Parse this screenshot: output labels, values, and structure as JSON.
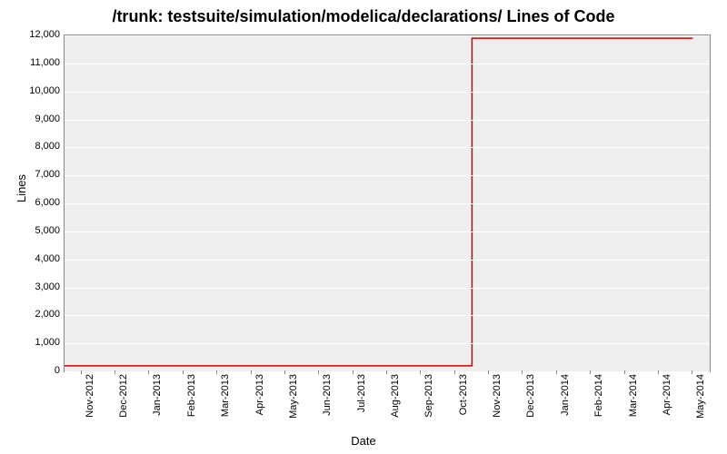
{
  "chart_data": {
    "type": "line",
    "title": "/trunk: testsuite/simulation/modelica/declarations/ Lines of Code",
    "xlabel": "Date",
    "ylabel": "Lines",
    "ylim": [
      0,
      12000
    ],
    "y_ticks": [
      0,
      1000,
      2000,
      3000,
      4000,
      5000,
      6000,
      7000,
      8000,
      9000,
      10000,
      11000,
      12000
    ],
    "y_tick_labels": [
      "0",
      "1,000",
      "2,000",
      "3,000",
      "4,000",
      "5,000",
      "6,000",
      "7,000",
      "8,000",
      "9,000",
      "10,000",
      "11,000",
      "12,000"
    ],
    "x_categories": [
      "Nov-2012",
      "Dec-2012",
      "Jan-2013",
      "Feb-2013",
      "Mar-2013",
      "Apr-2013",
      "May-2013",
      "Jun-2013",
      "Jul-2013",
      "Aug-2013",
      "Sep-2013",
      "Oct-2013",
      "Nov-2013",
      "Dec-2013",
      "Jan-2014",
      "Feb-2014",
      "Mar-2014",
      "Apr-2014",
      "May-2014"
    ],
    "series": [
      {
        "name": "Lines of Code",
        "color": "#d00000",
        "points": [
          {
            "x": "mid-Oct-2012",
            "y": 200
          },
          {
            "x": "mid-Oct-2013",
            "y": 200
          },
          {
            "x": "mid-Oct-2013",
            "y": 11900
          },
          {
            "x": "May-2014",
            "y": 11900
          }
        ]
      }
    ]
  }
}
